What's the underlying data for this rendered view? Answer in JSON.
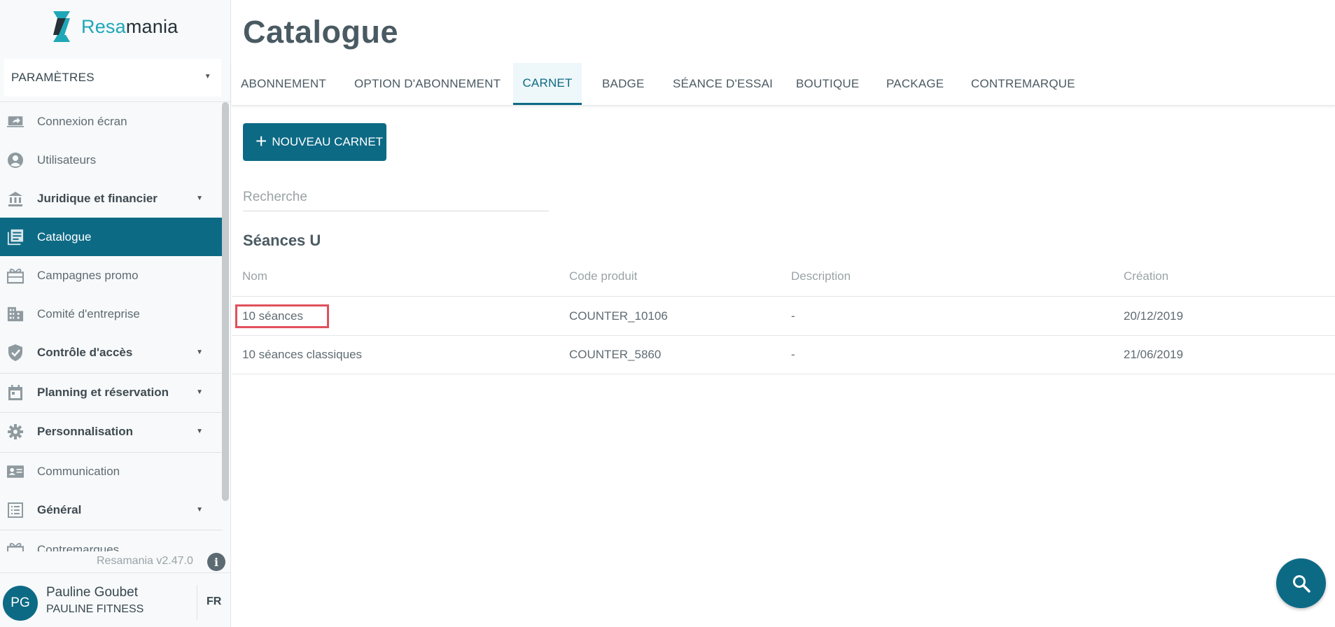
{
  "brand": {
    "name_part1": "Resa",
    "name_part2": "mania",
    "accent": "#1ea7b7",
    "primary": "#0d6a85"
  },
  "settings_select": {
    "label": "PARAMÈTRES"
  },
  "nav": {
    "items": [
      {
        "label": "Connexion écran",
        "icon": "screen-share-icon"
      },
      {
        "label": "Utilisateurs",
        "icon": "user-circle-icon"
      },
      {
        "label": "Juridique et financier",
        "icon": "bank-icon"
      },
      {
        "label": "Catalogue",
        "icon": "catalog-icon",
        "active": true
      },
      {
        "label": "Campagnes promo",
        "icon": "gift-icon"
      },
      {
        "label": "Comité d'entreprise",
        "icon": "building-icon"
      },
      {
        "label": "Contrôle d'accès",
        "icon": "shield-check-icon"
      },
      {
        "label": "Planning et réservation",
        "icon": "calendar-icon"
      },
      {
        "label": "Personnalisation",
        "icon": "gear-icon"
      },
      {
        "label": "Communication",
        "icon": "contact-card-icon"
      },
      {
        "label": "Général",
        "icon": "list-icon"
      },
      {
        "label": "Contremarques",
        "icon": "gift-icon"
      }
    ]
  },
  "footer": {
    "version": "Resamania v2.47.0",
    "user_initials": "PG",
    "user_name": "Pauline Goubet",
    "user_org": "PAULINE FITNESS",
    "lang": "FR"
  },
  "page": {
    "title": "Catalogue"
  },
  "tabs": [
    {
      "label": "ABONNEMENT"
    },
    {
      "label": "OPTION D'ABONNEMENT"
    },
    {
      "label": "CARNET",
      "active": true
    },
    {
      "label": "BADGE"
    },
    {
      "label": "SÉANCE D'ESSAI"
    },
    {
      "label": "BOUTIQUE"
    },
    {
      "label": "PACKAGE"
    },
    {
      "label": "CONTREMARQUE"
    }
  ],
  "actions": {
    "new_label": "NOUVEAU CARNET"
  },
  "search": {
    "placeholder": "Recherche",
    "value": ""
  },
  "section": {
    "title": "Séances U"
  },
  "table": {
    "headers": {
      "name": "Nom",
      "code": "Code produit",
      "description": "Description",
      "created": "Création"
    },
    "rows": [
      {
        "name": "10 séances",
        "code": "COUNTER_10106",
        "description": "-",
        "created": "20/12/2019"
      },
      {
        "name": "10 séances classiques",
        "code": "COUNTER_5860",
        "description": "-",
        "created": "21/06/2019"
      }
    ]
  }
}
